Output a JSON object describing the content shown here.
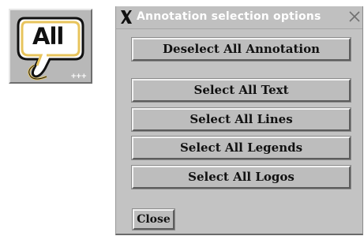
{
  "icon_button": {
    "label": "All",
    "badge": "+++"
  },
  "dialog": {
    "title": "Annotation selection options",
    "buttons": [
      {
        "label": "Deselect All Annotation"
      },
      {
        "label": "Select All Text"
      },
      {
        "label": "Select All Lines"
      },
      {
        "label": "Select All Legends"
      },
      {
        "label": "Select All Logos"
      }
    ],
    "close_label": "Close"
  },
  "colors": {
    "window_bg": "#c3c3c3",
    "button_bg": "#bdbdbd",
    "lasso": "#f0d48a"
  },
  "icons": {
    "window_menu": "x-logo-icon",
    "window_close": "close-x-icon",
    "toolbar": "lasso-select-icon"
  }
}
